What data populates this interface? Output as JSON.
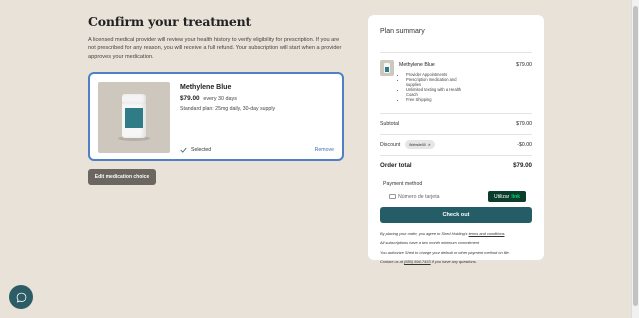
{
  "page": {
    "title": "Confirm your treatment",
    "intro": "A licensed medical provider will review your health history to verify eligibility for prescription. If you are not prescribed for any reason, you will receive a full refund. Your subscription will start when a provider approves your medication."
  },
  "product": {
    "name": "Methylene Blue",
    "price": "$79.00",
    "cycle": "every 30 days",
    "plan": "Standard plan: 25mg daily, 30-day supply",
    "selected_label": "Selected",
    "remove_label": "Remove"
  },
  "edit_button_label": "Edit medication choice",
  "summary": {
    "title": "Plan summary",
    "item_name": "Methylene Blue",
    "item_price": "$79.00",
    "features": [
      "Provider Appointments",
      "Prescription medication and supplies",
      "Unlimited texting with a Health Coach",
      "Free Shipping"
    ],
    "subtotal_label": "Subtotal",
    "subtotal_value": "$79.00",
    "discount_label": "Discount",
    "discount_code": "Website50",
    "discount_value": "-$0.00",
    "total_label": "Order total",
    "total_value": "$79.00"
  },
  "payment": {
    "title": "Payment method",
    "card_placeholder": "Número de tarjeta",
    "link_button_label": "Utilizar",
    "link_badge": "link",
    "checkout_label": "Check out"
  },
  "legal": {
    "line1_prefix": "By placing your order, you agree to Shed Holding's",
    "line1_link": "terms and conditions",
    "line1_suffix": ".",
    "line2": "All subscriptions have a two month minimum commitment",
    "line3": "You authorize Shed to charge your default or other payment method on file.",
    "line4_prefix": "Contact us at",
    "line4_link": "(650) 694-7433",
    "line4_suffix": "if you have any questions."
  },
  "colors": {
    "background": "#e8e2d9",
    "accent": "#245d66",
    "selected_border": "#4f7fc4",
    "edit_button": "#6b6660",
    "link_button": "#0b3d2c"
  }
}
